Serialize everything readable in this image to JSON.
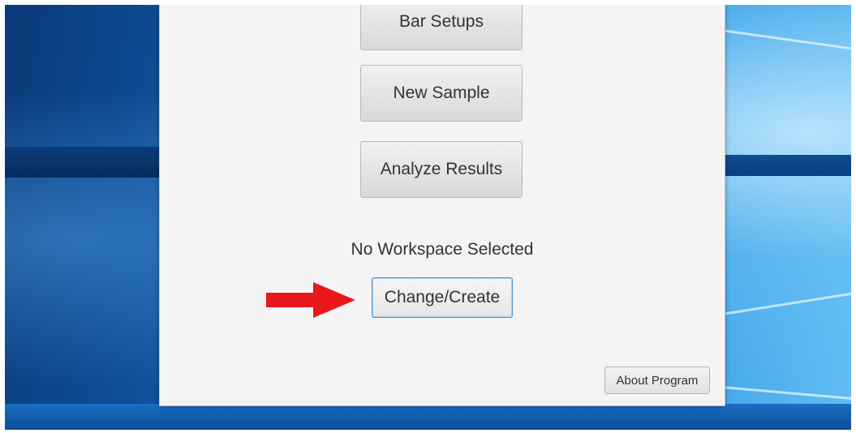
{
  "app": {
    "buttons": {
      "bar_setups": "Bar Setups",
      "new_sample": "New Sample",
      "analyze_results": "Analyze Results",
      "change_create": "Change/Create",
      "about_program": "About Program"
    },
    "workspace_status": "No Workspace Selected"
  },
  "annotation": {
    "arrow_color": "#e8171b"
  },
  "colors": {
    "window_background": "#f4f4f4",
    "desktop_accent": "#1565b8",
    "focus_border": "#4f94cf"
  }
}
